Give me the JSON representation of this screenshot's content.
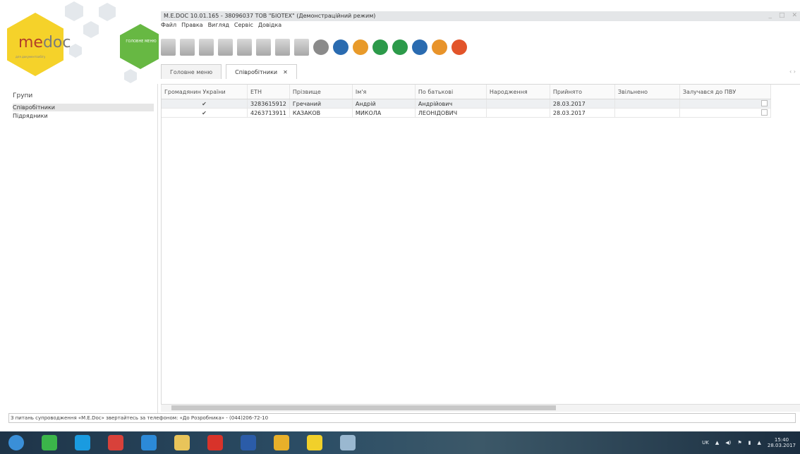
{
  "window": {
    "title": "M.E.DOC 10.01.165 - 38096037 ТОВ \"БІОТЕХ\" (Демонстраційний режим)",
    "controls": [
      "_",
      "□",
      "✕"
    ]
  },
  "logo": {
    "brand_prefix": "me",
    "brand_suffix": "doc",
    "tagline": "для документообігу",
    "main_menu_label": "ГОЛОВНЕ МЕНЮ"
  },
  "menu": [
    "Файл",
    "Правка",
    "Вигляд",
    "Сервіс",
    "Довідка"
  ],
  "toolbar": {
    "icons": [
      {
        "name": "create-doc-icon",
        "color": "grey"
      },
      {
        "name": "open-doc-icon",
        "color": "grey"
      },
      {
        "name": "save-doc-icon",
        "color": "grey"
      },
      {
        "name": "copy-doc-icon",
        "color": "grey"
      },
      {
        "name": "edit-doc-icon",
        "color": "grey"
      },
      {
        "name": "add-record-icon",
        "color": "grey"
      },
      {
        "name": "search-record-icon",
        "color": "grey"
      },
      {
        "name": "delete-record-icon",
        "color": "grey"
      },
      {
        "name": "archive-icon",
        "color": "#8a8a8a"
      },
      {
        "name": "print-icon",
        "color": "#2a6bb0"
      },
      {
        "name": "send-icon",
        "color": "#e89a2a"
      },
      {
        "name": "sign-icon",
        "color": "#2c9a4a"
      },
      {
        "name": "check-icon",
        "color": "#2c9a4a"
      },
      {
        "name": "refresh-icon",
        "color": "#2a6bb0"
      },
      {
        "name": "help-icon",
        "color": "#e8932a"
      },
      {
        "name": "feedback-icon",
        "color": "#e2542a"
      }
    ]
  },
  "tabs": [
    {
      "label": "Головне меню",
      "active": false,
      "closable": false
    },
    {
      "label": "Співробітники",
      "active": true,
      "closable": true,
      "close": "✕"
    }
  ],
  "tab_nav": "‹ ›",
  "left_panel": {
    "title": "Групи",
    "items": [
      {
        "label": "Співробітники",
        "selected": true
      },
      {
        "label": "Підрядники",
        "selected": false
      }
    ]
  },
  "grid": {
    "columns": [
      "Громадянин України",
      "ЕТН",
      "Прізвище",
      "Ім'я",
      "По батькові",
      "Народження",
      "Прийнято",
      "Звільнено",
      "Залучався до ПВУ"
    ],
    "rows": [
      {
        "citizen": "✔",
        "etn": "3283615912",
        "surname": "Гречаний",
        "name": "Андрій",
        "patronymic": "Андрійович",
        "birth": "",
        "hired": "28.03.2017",
        "fired": "",
        "pvu": false
      },
      {
        "citizen": "✔",
        "etn": "4263713911",
        "surname": "КАЗАКОВ",
        "name": "МИКОЛА",
        "patronymic": "ЛЕОНІДОВИЧ",
        "birth": "",
        "hired": "28.03.2017",
        "fired": "",
        "pvu": false
      }
    ]
  },
  "status": "З питань супроводження «M.E.Doc» звертайтесь за телефоном: «До Розробника» - (044)206-72-10",
  "taskbar": {
    "apps": [
      {
        "name": "start-icon",
        "color": "#3a8fd8"
      },
      {
        "name": "shield-icon",
        "color": "#3bb54a"
      },
      {
        "name": "skype-icon",
        "color": "#1a9be0"
      },
      {
        "name": "ccleaner-icon",
        "color": "#d8413a"
      },
      {
        "name": "globe-icon",
        "color": "#2c8ad8"
      },
      {
        "name": "folder-icon",
        "color": "#e8c45a"
      },
      {
        "name": "opera-icon",
        "color": "#d8332a"
      },
      {
        "name": "word-icon",
        "color": "#2b5ca8"
      },
      {
        "name": "chrome-icon",
        "color": "#e8b02a"
      },
      {
        "name": "medoc-icon",
        "color": "#f1d02a"
      },
      {
        "name": "paint-icon",
        "color": "#9ab8d0"
      }
    ],
    "lang": "UK",
    "time": "15:40",
    "date": "28.03.2017"
  }
}
